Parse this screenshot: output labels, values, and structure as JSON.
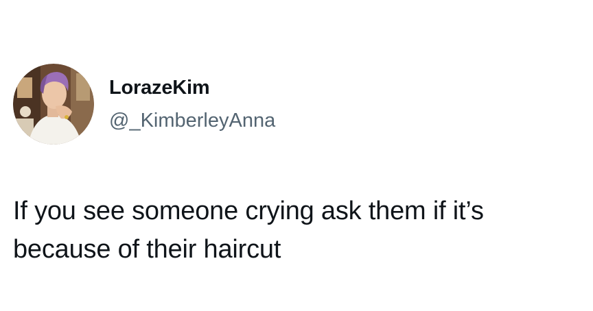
{
  "author": {
    "display_name": "LorazeKim",
    "handle": "@_KimberleyAnna",
    "avatar_icon": "profile-photo-avatar"
  },
  "tweet": {
    "lines": [
      "If you see someone crying ask them if it’s",
      "because of their haircut"
    ]
  },
  "colors": {
    "text": "#0f1419",
    "handle": "#536471",
    "background": "#ffffff",
    "avatar_hair": "#9b6fb7"
  }
}
